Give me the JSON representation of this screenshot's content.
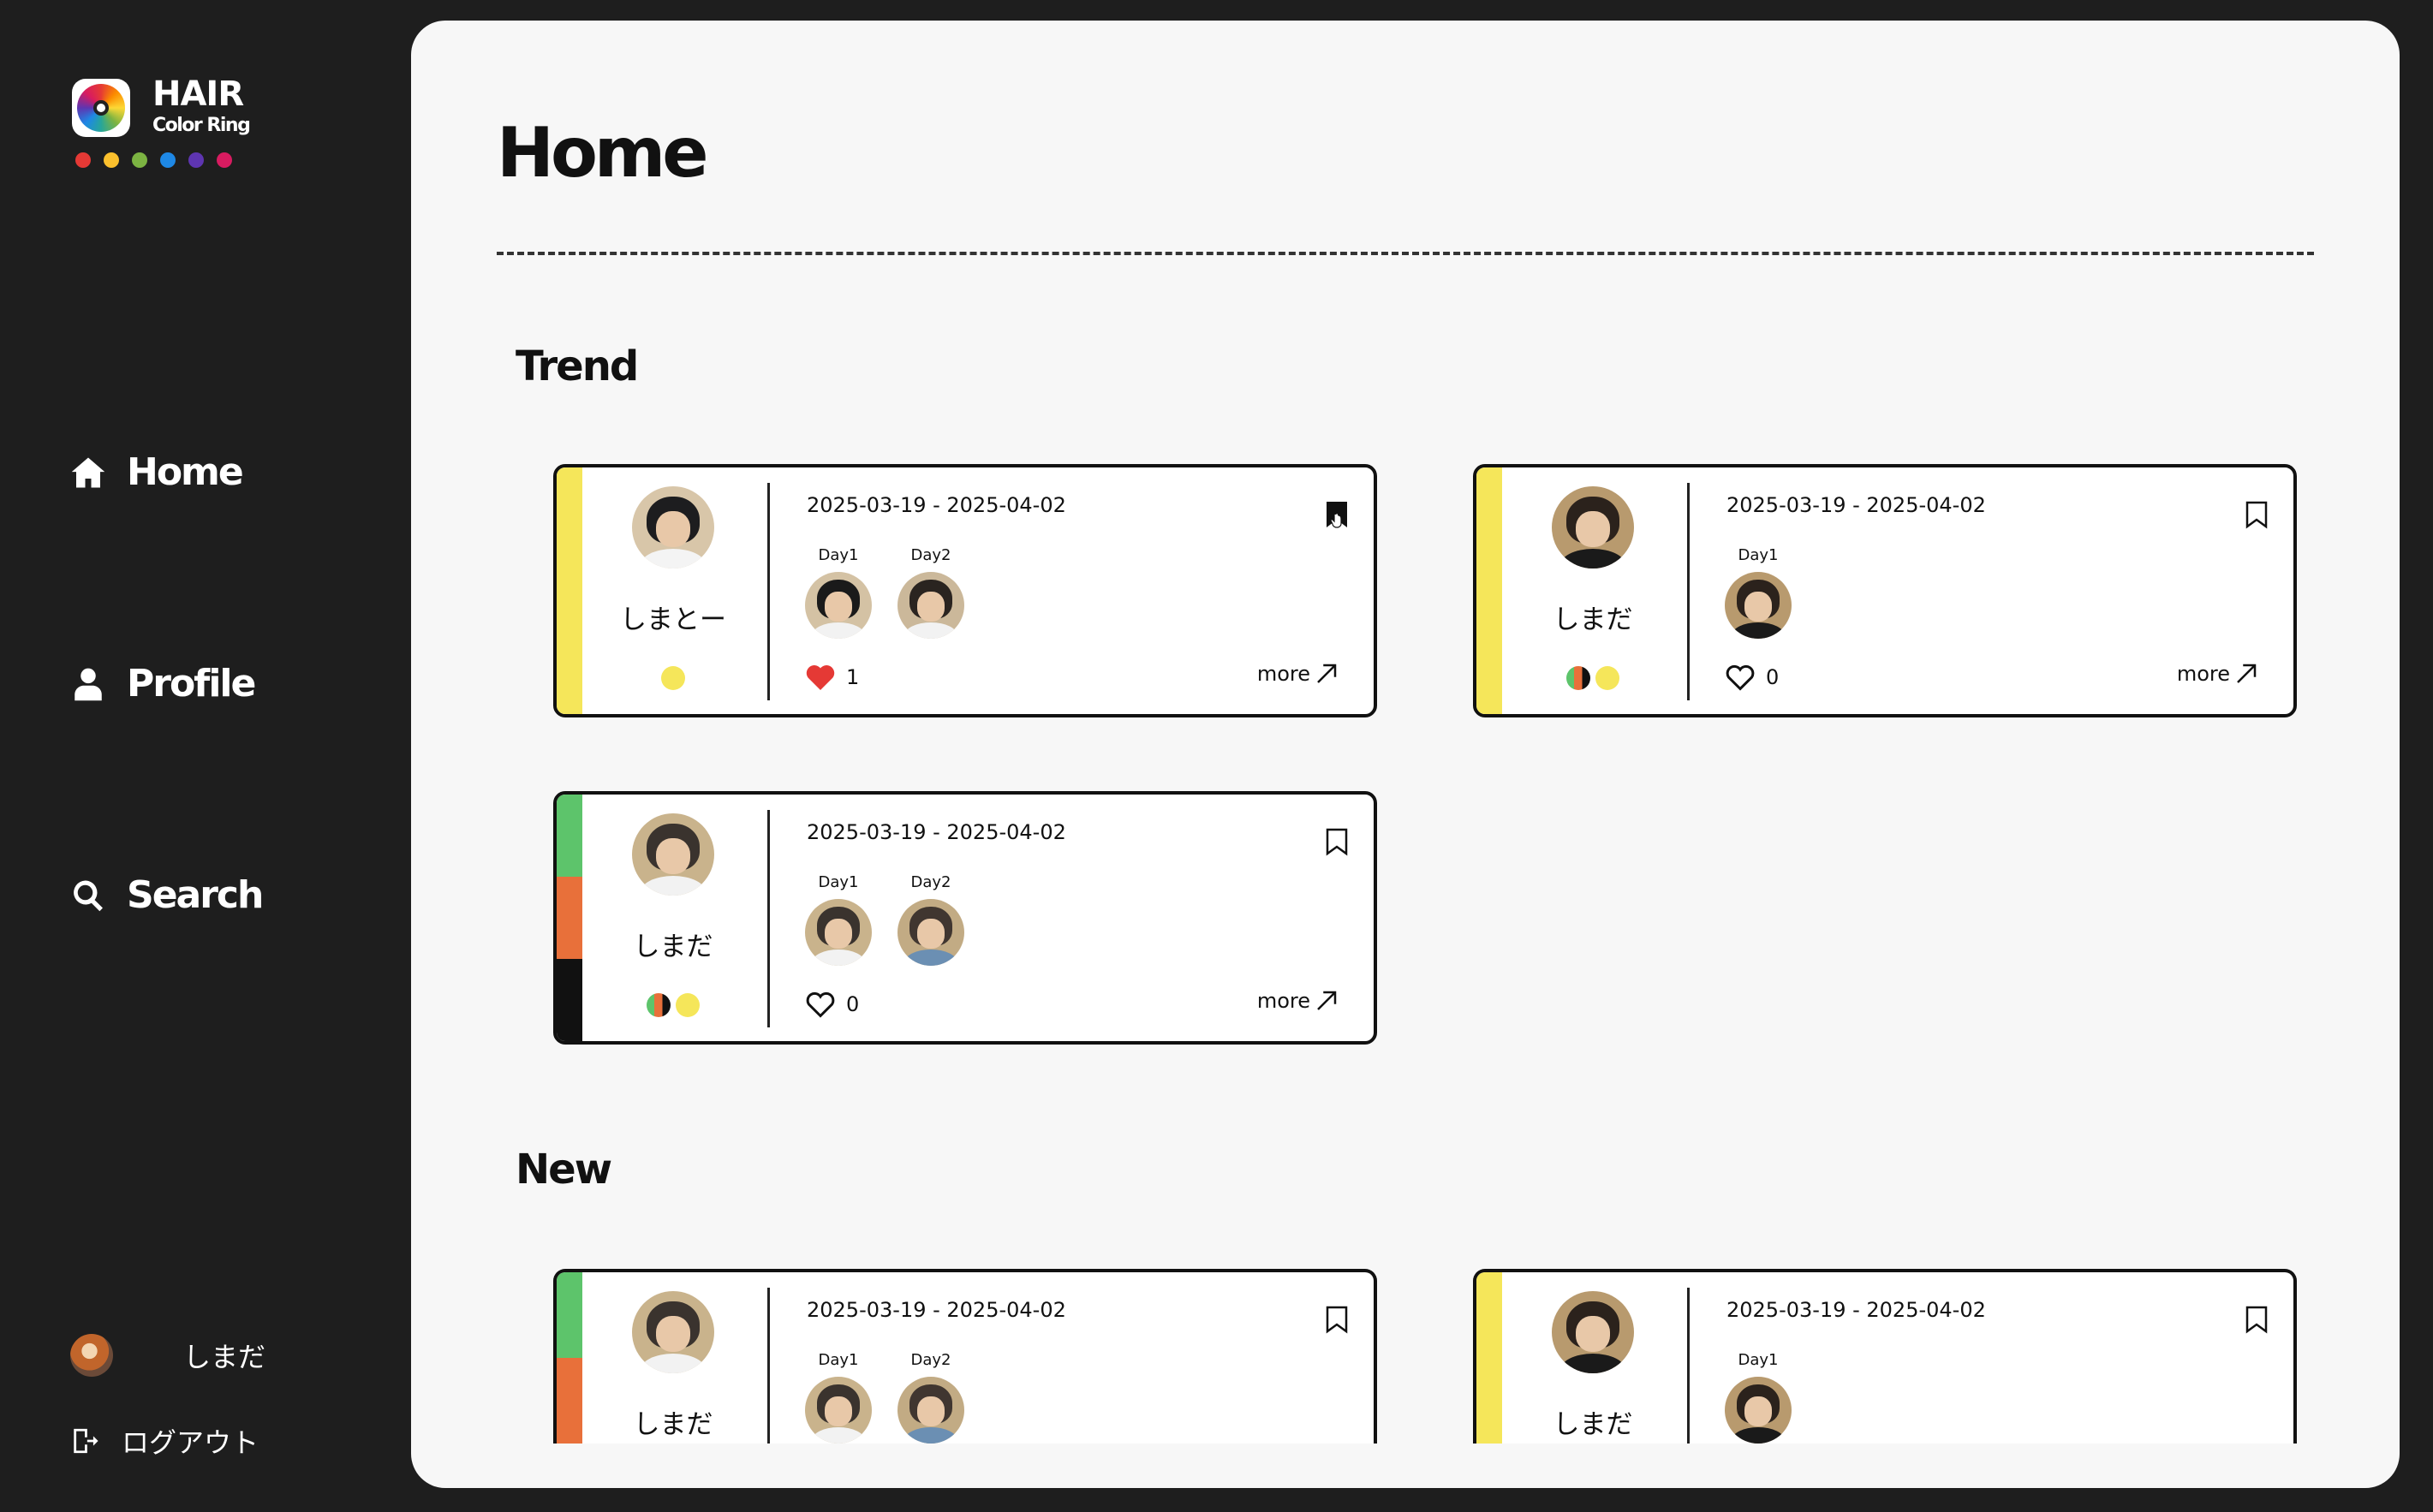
{
  "app": {
    "logo_title": "HAIR",
    "logo_subtitle": "Color Ring",
    "logo_dots": [
      "#e53935",
      "#fbc02d",
      "#7cb342",
      "#1e88e5",
      "#5e35b1",
      "#d81b60"
    ]
  },
  "sidebar": {
    "items": [
      {
        "label": "Home",
        "icon": "home-icon"
      },
      {
        "label": "Profile",
        "icon": "person-icon"
      },
      {
        "label": "Search",
        "icon": "search-icon"
      }
    ],
    "user_name": "しまだ",
    "logout_label": "ログアウト"
  },
  "main": {
    "page_title": "Home",
    "sections": [
      {
        "title": "Trend"
      },
      {
        "title": "New"
      }
    ]
  },
  "cards": [
    {
      "user": "しまとー",
      "date_range": "2025-03-19 - 2025-04-02",
      "days": [
        {
          "label": "Day1"
        },
        {
          "label": "Day2"
        }
      ],
      "likes": "1",
      "liked": true,
      "bookmarked": true,
      "more_label": "more",
      "stripe": [
        "#f5e65a"
      ],
      "color_dots": [
        "#f5e65a"
      ]
    },
    {
      "user": "しまだ",
      "date_range": "2025-03-19 - 2025-04-02",
      "days": [
        {
          "label": "Day1"
        }
      ],
      "likes": "0",
      "liked": false,
      "bookmarked": false,
      "more_label": "more",
      "stripe": [
        "#f5e65a"
      ],
      "color_dots": [
        "multi",
        "#f5e65a"
      ]
    },
    {
      "user": "しまだ",
      "date_range": "2025-03-19 - 2025-04-02",
      "days": [
        {
          "label": "Day1"
        },
        {
          "label": "Day2"
        }
      ],
      "likes": "0",
      "liked": false,
      "bookmarked": false,
      "more_label": "more",
      "stripe": [
        "#5dc46b",
        "#e8703a",
        "#111111"
      ],
      "color_dots": [
        "multi",
        "#f5e65a"
      ]
    },
    {
      "user": "しまだ",
      "date_range": "2025-03-19 - 2025-04-02",
      "days": [
        {
          "label": "Day1"
        },
        {
          "label": "Day2"
        }
      ],
      "bookmarked": false,
      "stripe": [
        "#5dc46b",
        "#e8703a",
        "#111111"
      ]
    },
    {
      "user": "しまだ",
      "date_range": "2025-03-19 - 2025-04-02",
      "days": [
        {
          "label": "Day1"
        }
      ],
      "bookmarked": false,
      "stripe": [
        "#f5e65a"
      ]
    }
  ],
  "colors": {
    "sidebar_bg": "#1e1e1e",
    "panel_bg": "#f7f7f7",
    "like_red": "#e53935",
    "accent_yellow": "#f5e65a"
  }
}
